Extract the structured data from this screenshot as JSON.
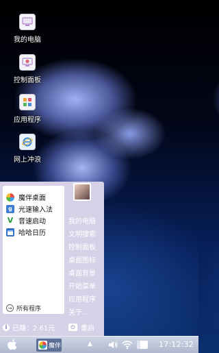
{
  "desktop": {
    "icons": [
      {
        "label": "我的电脑",
        "icon": "computer-icon"
      },
      {
        "label": "控制面板",
        "icon": "control-panel-icon"
      },
      {
        "label": "应用程序",
        "icon": "applications-icon"
      },
      {
        "label": "网上冲浪",
        "icon": "internet-explorer-icon"
      }
    ]
  },
  "start_menu": {
    "apps": [
      {
        "label": "魔伴桌面",
        "icon": "pinwheel-icon"
      },
      {
        "label": "光速输入法",
        "icon": "input-method-icon"
      },
      {
        "label": "音速启动",
        "icon": "quick-launch-icon"
      },
      {
        "label": "哈哈日历",
        "icon": "calendar-icon"
      }
    ],
    "all_programs_label": "所有程序",
    "earned_label": "已赚：2.61元",
    "links": [
      "我的电脑",
      "文明搜索",
      "控制面板",
      "桌面图标",
      "桌面背景",
      "开始菜单",
      "应用程序",
      "关于.."
    ],
    "restart_label": "重启"
  },
  "taskbar": {
    "active_task_label": "魔伴",
    "clock": "17:12:32"
  },
  "colors": {
    "menu_bg": "#d7d1e8",
    "taskbar_bg": "#b8c0d4",
    "task_item_bg": "#5d6f95"
  }
}
